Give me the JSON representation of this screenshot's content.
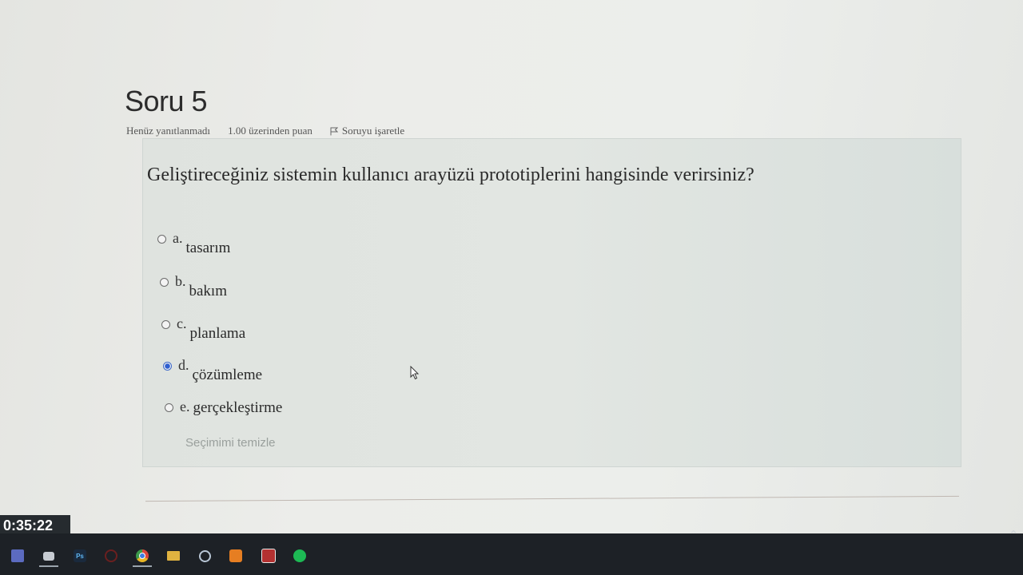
{
  "question": {
    "title": "Soru 5",
    "status": "Henüz yanıtlanmadı",
    "mark": "1.00 üzerinden puan",
    "flag_label": "Soruyu işaretle",
    "text": "Geliştireceğiniz sistemin kullanıcı arayüzü prototiplerini hangisinde verirsiniz?",
    "clear_label": "Seçimimi temizle"
  },
  "answers": [
    {
      "letter": "a.",
      "text": "tasarım",
      "checked": false
    },
    {
      "letter": "b.",
      "text": "bakım",
      "checked": false
    },
    {
      "letter": "c.",
      "text": "planlama",
      "checked": false
    },
    {
      "letter": "d.",
      "text": "çözümleme",
      "checked": true
    },
    {
      "letter": "e.",
      "text": "gerçekleştirme",
      "checked": false
    }
  ],
  "timer": {
    "value": "0:35:22"
  },
  "taskbar": {
    "icons": [
      "visual-studio-icon",
      "app-window-icon",
      "photoshop-icon",
      "opera-icon",
      "chrome-icon",
      "file-explorer-icon",
      "steam-icon",
      "office-icon",
      "mail-icon",
      "spotify-icon"
    ],
    "photoshop_label": "Ps"
  },
  "colors": {
    "selected_radio": "#2f5fd0",
    "taskbar_bg": "#1d2126",
    "spotify": "#1db954",
    "chrome": "#e8b524"
  }
}
